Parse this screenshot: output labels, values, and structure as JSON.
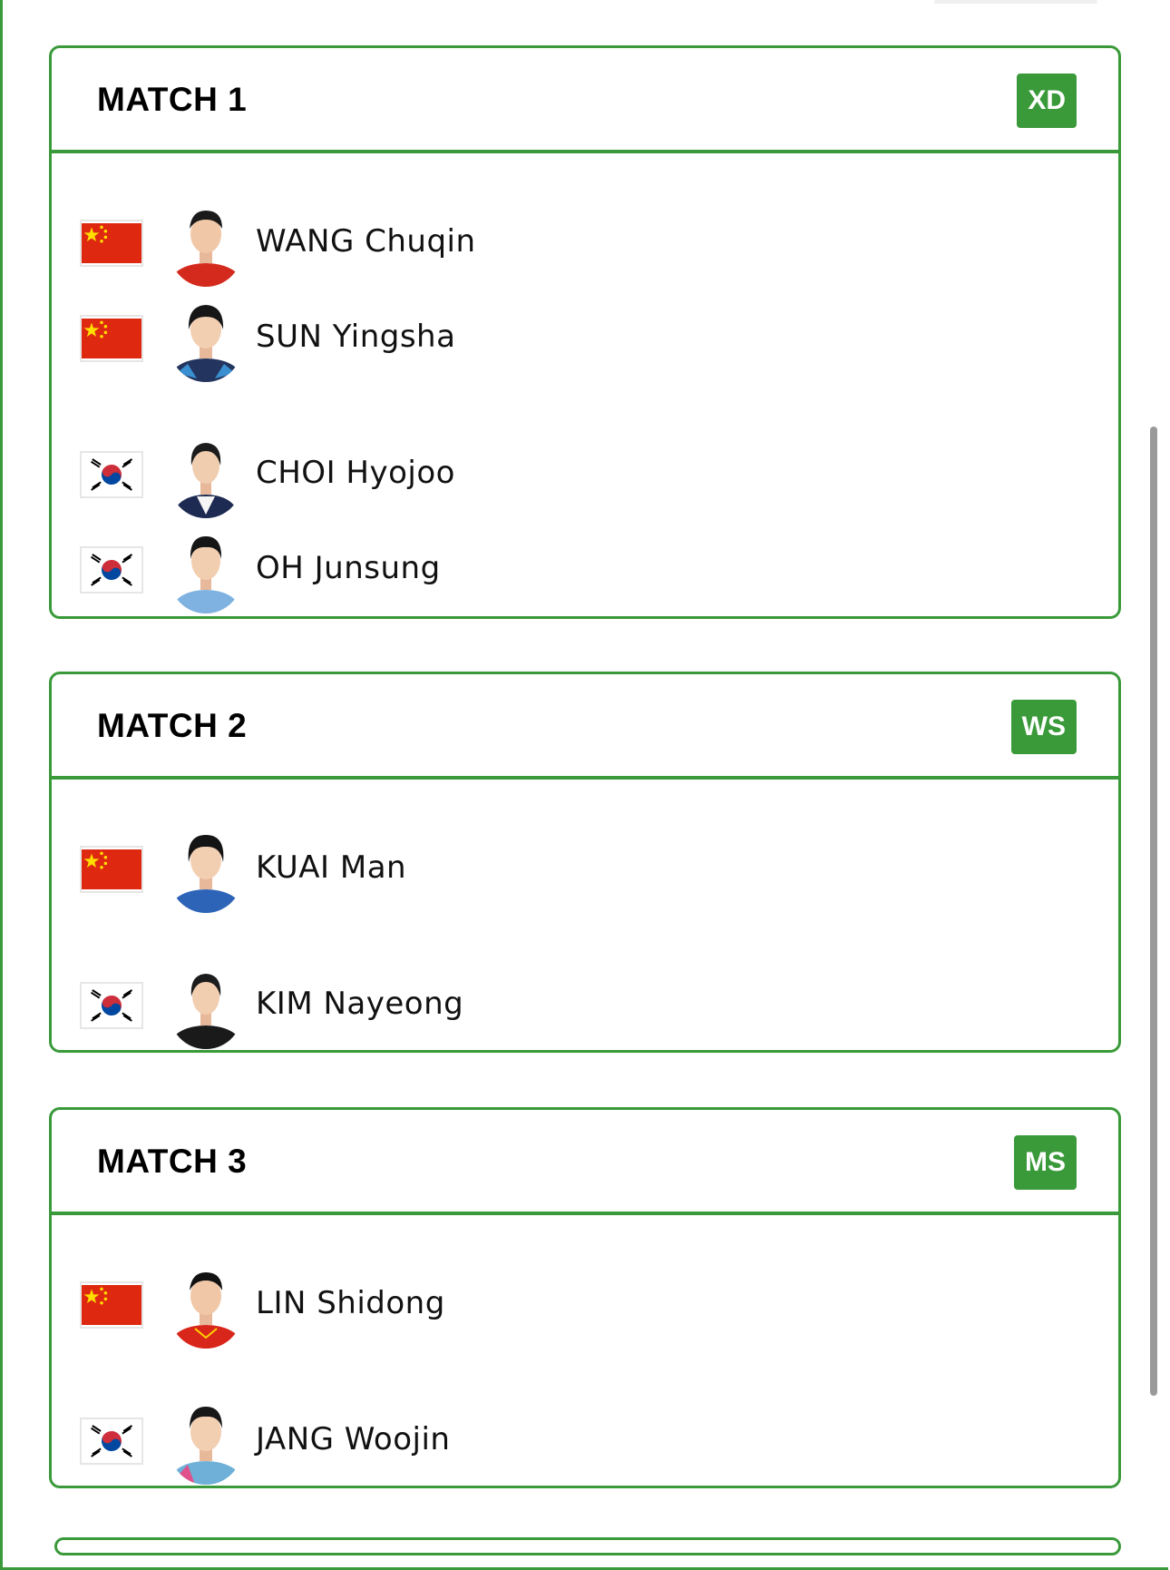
{
  "colors": {
    "accent": "#3a9a3a",
    "china_red": "#de2910",
    "korea_red": "#cd2e3a",
    "korea_blue": "#0047a0"
  },
  "matches": [
    {
      "title": "MATCH 1",
      "badge": "XD",
      "players": [
        {
          "name": "WANG Chuqin",
          "flag": "china-flag-icon"
        },
        {
          "name": "SUN Yingsha",
          "flag": "china-flag-icon"
        },
        {
          "name": "CHOI Hyojoo",
          "flag": "korea-flag-icon"
        },
        {
          "name": "OH Junsung",
          "flag": "korea-flag-icon"
        }
      ]
    },
    {
      "title": "MATCH 2",
      "badge": "WS",
      "players": [
        {
          "name": "KUAI Man",
          "flag": "china-flag-icon"
        },
        {
          "name": "KIM Nayeong",
          "flag": "korea-flag-icon"
        }
      ]
    },
    {
      "title": "MATCH 3",
      "badge": "MS",
      "players": [
        {
          "name": "LIN Shidong",
          "flag": "china-flag-icon"
        },
        {
          "name": "JANG Woojin",
          "flag": "korea-flag-icon"
        }
      ]
    }
  ]
}
